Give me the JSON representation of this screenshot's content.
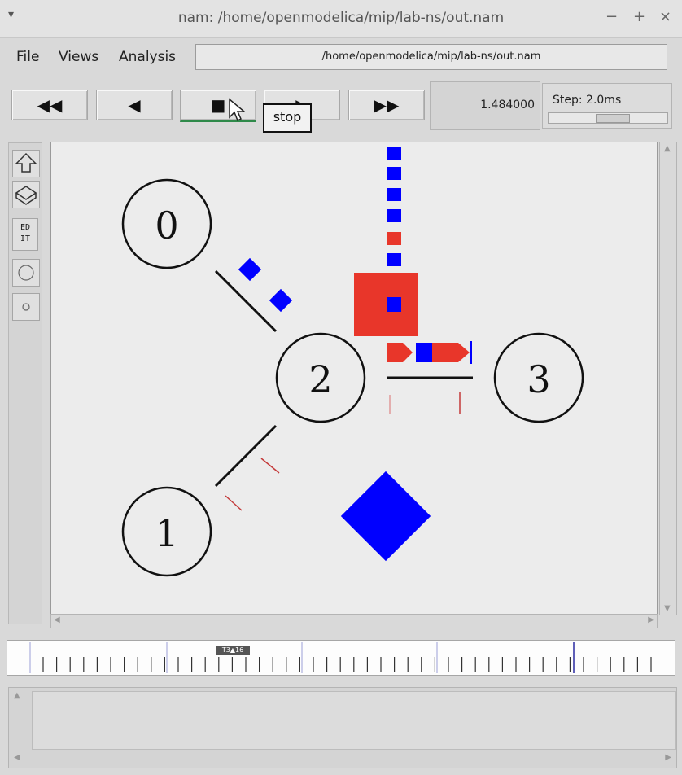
{
  "window": {
    "title": "nam: /home/openmodelica/mip/lab-ns/out.nam",
    "minimize_glyph": "−",
    "maximize_glyph": "+",
    "close_glyph": "×",
    "menu_glyph": "▾"
  },
  "menubar": {
    "file": "File",
    "views": "Views",
    "analysis": "Analysis",
    "path": "/home/openmodelica/mip/lab-ns/out.nam"
  },
  "toolbar": {
    "rewind_glyph": "◀◀",
    "back_glyph": "◀",
    "stop_glyph": "■",
    "play_glyph": "▶",
    "fastforward_glyph": "▶▶",
    "time": "1.484000",
    "step_label": "Step: 2.0ms",
    "tooltip": "stop"
  },
  "toolcol": {
    "edit_label": "ED IT"
  },
  "network": {
    "nodes": [
      {
        "id": "0"
      },
      {
        "id": "1"
      },
      {
        "id": "2"
      },
      {
        "id": "3"
      }
    ],
    "links": [
      {
        "from": "0",
        "to": "2"
      },
      {
        "from": "1",
        "to": "2"
      },
      {
        "from": "2",
        "to": "3"
      }
    ],
    "colors": {
      "packet": "#0000ff",
      "drop": "#e8362a",
      "queue_marker": "#c43a3a",
      "link": "#111111",
      "canvas": "#ececec"
    }
  },
  "timeline": {
    "marker_label": "T3▲16"
  },
  "icons": [
    "up-arrow-icon",
    "3d-view-icon",
    "edit-icon",
    "circle-icon",
    "small-circle-icon"
  ]
}
